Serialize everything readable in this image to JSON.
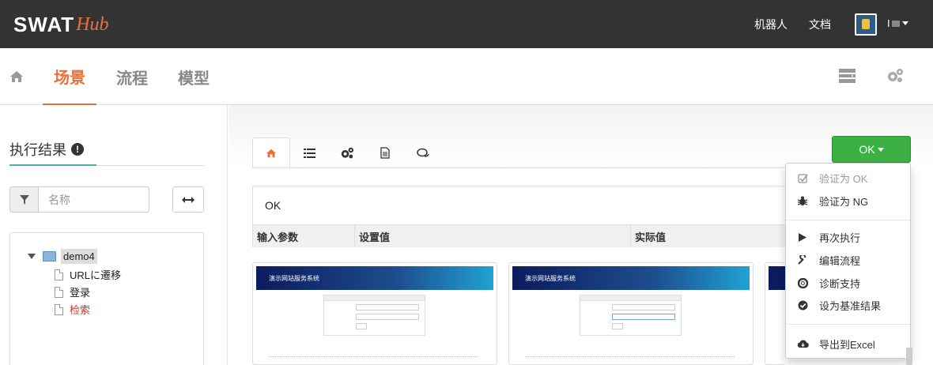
{
  "brand": {
    "swat": "SWAT",
    "hub": "Hub",
    "accent": "#e8703a"
  },
  "topnav": {
    "robots": "机器人",
    "docs": "文档",
    "user": "I"
  },
  "subnav": {
    "tabs": [
      "场景",
      "流程",
      "模型"
    ],
    "active": "场景"
  },
  "left": {
    "title": "执行结果",
    "filter_placeholder": "名称",
    "tree": {
      "root": "demo4",
      "children": [
        "URLに遷移",
        "登录",
        "检索"
      ],
      "highlight_color": "#c0392b"
    }
  },
  "main": {
    "tab_icons": [
      "home-icon",
      "list-icon",
      "cogs-icon",
      "file-icon",
      "comments-icon"
    ],
    "ok_button": "OK",
    "result_status": "OK",
    "table_headers": [
      "输入参数",
      "设置值",
      "实际值"
    ],
    "screenshot_header": "演示网站服务系统"
  },
  "menu": {
    "items": [
      {
        "label": "验证为 OK",
        "icon": "check-square-icon",
        "disabled": true
      },
      {
        "label": "验证为 NG",
        "icon": "bug-icon",
        "disabled": false
      },
      {
        "label": "再次执行",
        "icon": "play-icon",
        "disabled": false
      },
      {
        "label": "编辑流程",
        "icon": "wrench-icon",
        "disabled": false
      },
      {
        "label": "诊断支持",
        "icon": "life-ring-icon",
        "disabled": false
      },
      {
        "label": "设为基准结果",
        "icon": "check-circle-icon",
        "disabled": false
      },
      {
        "label": "导出到Excel",
        "icon": "cloud-download-icon",
        "disabled": false
      }
    ]
  },
  "colors": {
    "topbar": "#333333",
    "ok_green": "#3cb043",
    "tab_active": "#e8703a"
  }
}
